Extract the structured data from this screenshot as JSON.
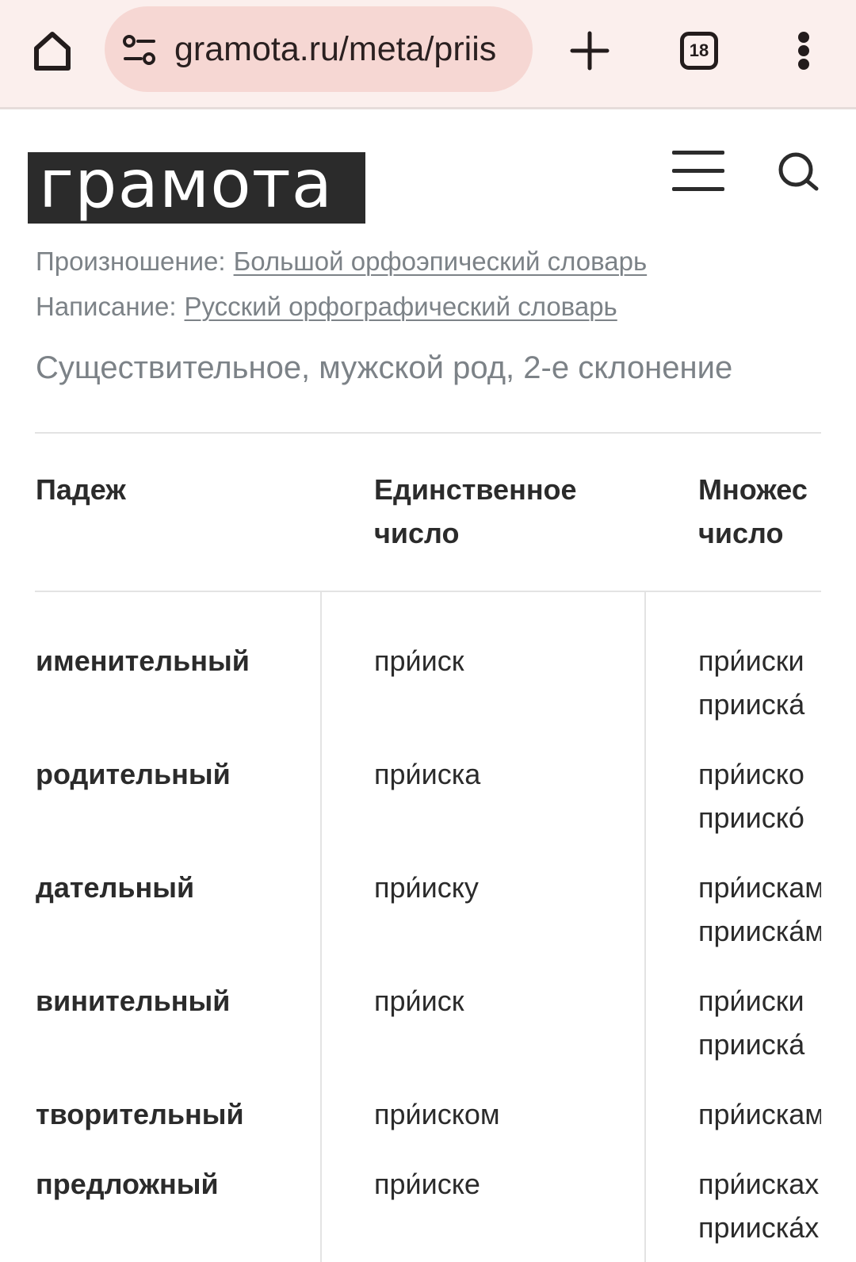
{
  "browser": {
    "url": "gramota.ru/meta/priis",
    "tab_count": "18"
  },
  "site": {
    "logo": "грамота"
  },
  "meta": {
    "pronunciation_label": "Произношение:",
    "pronunciation_link": "Большой орфоэпический словарь",
    "spelling_label": "Написание:",
    "spelling_link": "Русский орфографический словарь",
    "grammar": "Существительное, мужской род, 2-е склонение"
  },
  "table": {
    "headers": {
      "case": "Падеж",
      "singular_1": "Единственное",
      "singular_2": "число",
      "plural_1": "Множес",
      "plural_2": "число"
    },
    "rows": [
      {
        "case": "именительный",
        "singular": "при́иск",
        "plural_1": "при́иски",
        "plural_2": "прииска́"
      },
      {
        "case": "родительный",
        "singular": "при́иска",
        "plural_1": "при́иско",
        "plural_2": "прииско́"
      },
      {
        "case": "дательный",
        "singular": "при́иску",
        "plural_1": "при́искам",
        "plural_2": "прииска́м"
      },
      {
        "case": "винительный",
        "singular": "при́иск",
        "plural_1": "при́иски",
        "plural_2": "прииска́"
      },
      {
        "case": "творительный",
        "singular": "при́иском",
        "plural_1": "при́искам",
        "plural_2": ""
      },
      {
        "case": "предложный",
        "singular": "при́иске",
        "plural_1": "при́искаx",
        "plural_2": "прииска́x"
      }
    ]
  }
}
